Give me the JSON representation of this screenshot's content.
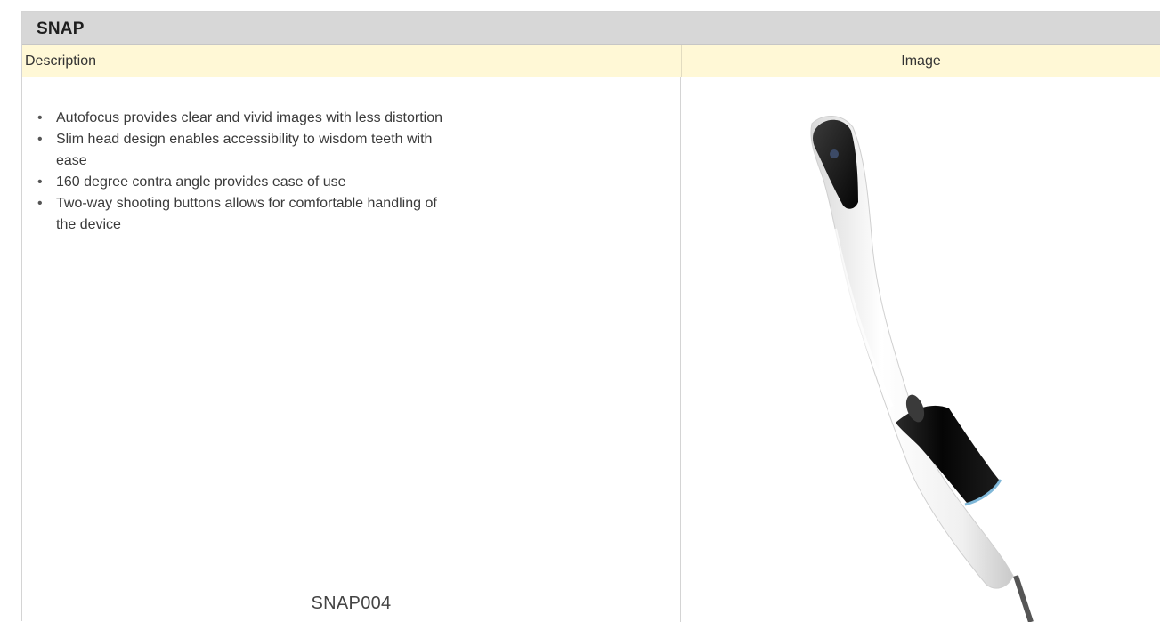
{
  "table": {
    "title": "SNAP",
    "headers": {
      "description": "Description",
      "image": "Image"
    },
    "features": [
      "Autofocus provides clear and vivid images with less distortion",
      "Slim head design enables accessibility to wisdom teeth with ease",
      "160 degree contra angle provides ease of use",
      "Two-way shooting buttons allows for comfortable handling of the device"
    ],
    "bullet": "•",
    "model": "SNAP004"
  },
  "product_image": {
    "icon": "intraoral-camera-icon",
    "colors": {
      "body": "#f4f4f4",
      "grip": "#111111",
      "accent_ring": "#7fb7d8",
      "cable": "#555555"
    }
  }
}
